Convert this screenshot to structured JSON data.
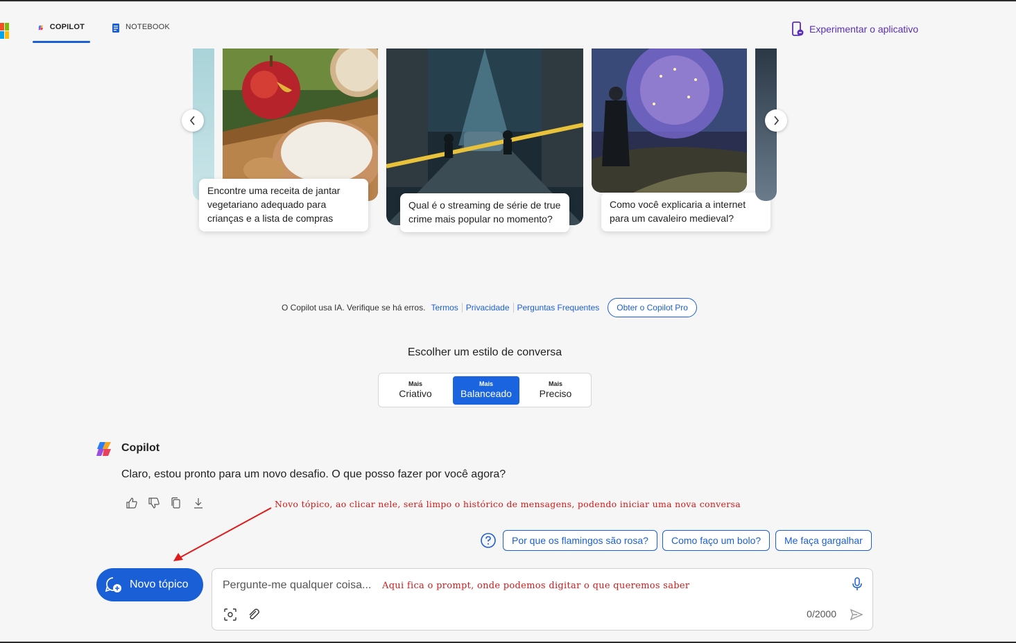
{
  "header": {
    "tabs": [
      {
        "label": "COPILOT"
      },
      {
        "label": "NOTEBOOK"
      }
    ],
    "try_app": "Experimentar o aplicativo"
  },
  "carousel": {
    "cards": [
      {
        "text": "Encontre uma receita de jantar vegetariano adequado para crianças e a lista de compras",
        "image": "apple-rice-icon"
      },
      {
        "text": "Qual é o streaming de série de true crime mais popular no momento?",
        "image": "crime-scene-icon"
      },
      {
        "text": "Como você explicaria a internet para um cavaleiro medieval?",
        "image": "knight-globe-icon"
      }
    ]
  },
  "disclaimer": {
    "text": "O Copilot usa IA. Verifique se há erros.",
    "links": [
      "Termos",
      "Privacidade",
      "Perguntas Frequentes"
    ],
    "pro_button": "Obter o Copilot Pro"
  },
  "style_picker": {
    "title": "Escolher um estilo de conversa",
    "options": [
      {
        "small": "Mais",
        "big": "Criativo"
      },
      {
        "small": "Mais",
        "big": "Balanceado"
      },
      {
        "small": "Mais",
        "big": "Preciso"
      }
    ],
    "selected": "Balanceado"
  },
  "chat": {
    "sender": "Copilot",
    "message": "Claro, estou pronto para um novo desafio. O que posso fazer por você agora?"
  },
  "annotations": {
    "new_topic_note": "Novo tópico, ao clicar nele, será limpo o histórico de mensagens, podendo iniciar uma nova conversa",
    "prompt_note": "Aqui fica o prompt, onde podemos digitar o que queremos saber"
  },
  "suggestions": [
    "Por que os flamingos são rosa?",
    "Como faço um bolo?",
    "Me faça gargalhar"
  ],
  "new_topic": "Novo tópico",
  "input": {
    "placeholder": "Pergunte-me qualquer coisa...",
    "char_count": "0/2000"
  },
  "colors": {
    "accent": "#1b5fd6",
    "annotation": "#d11a1a",
    "app_link": "#5a2fb8"
  }
}
